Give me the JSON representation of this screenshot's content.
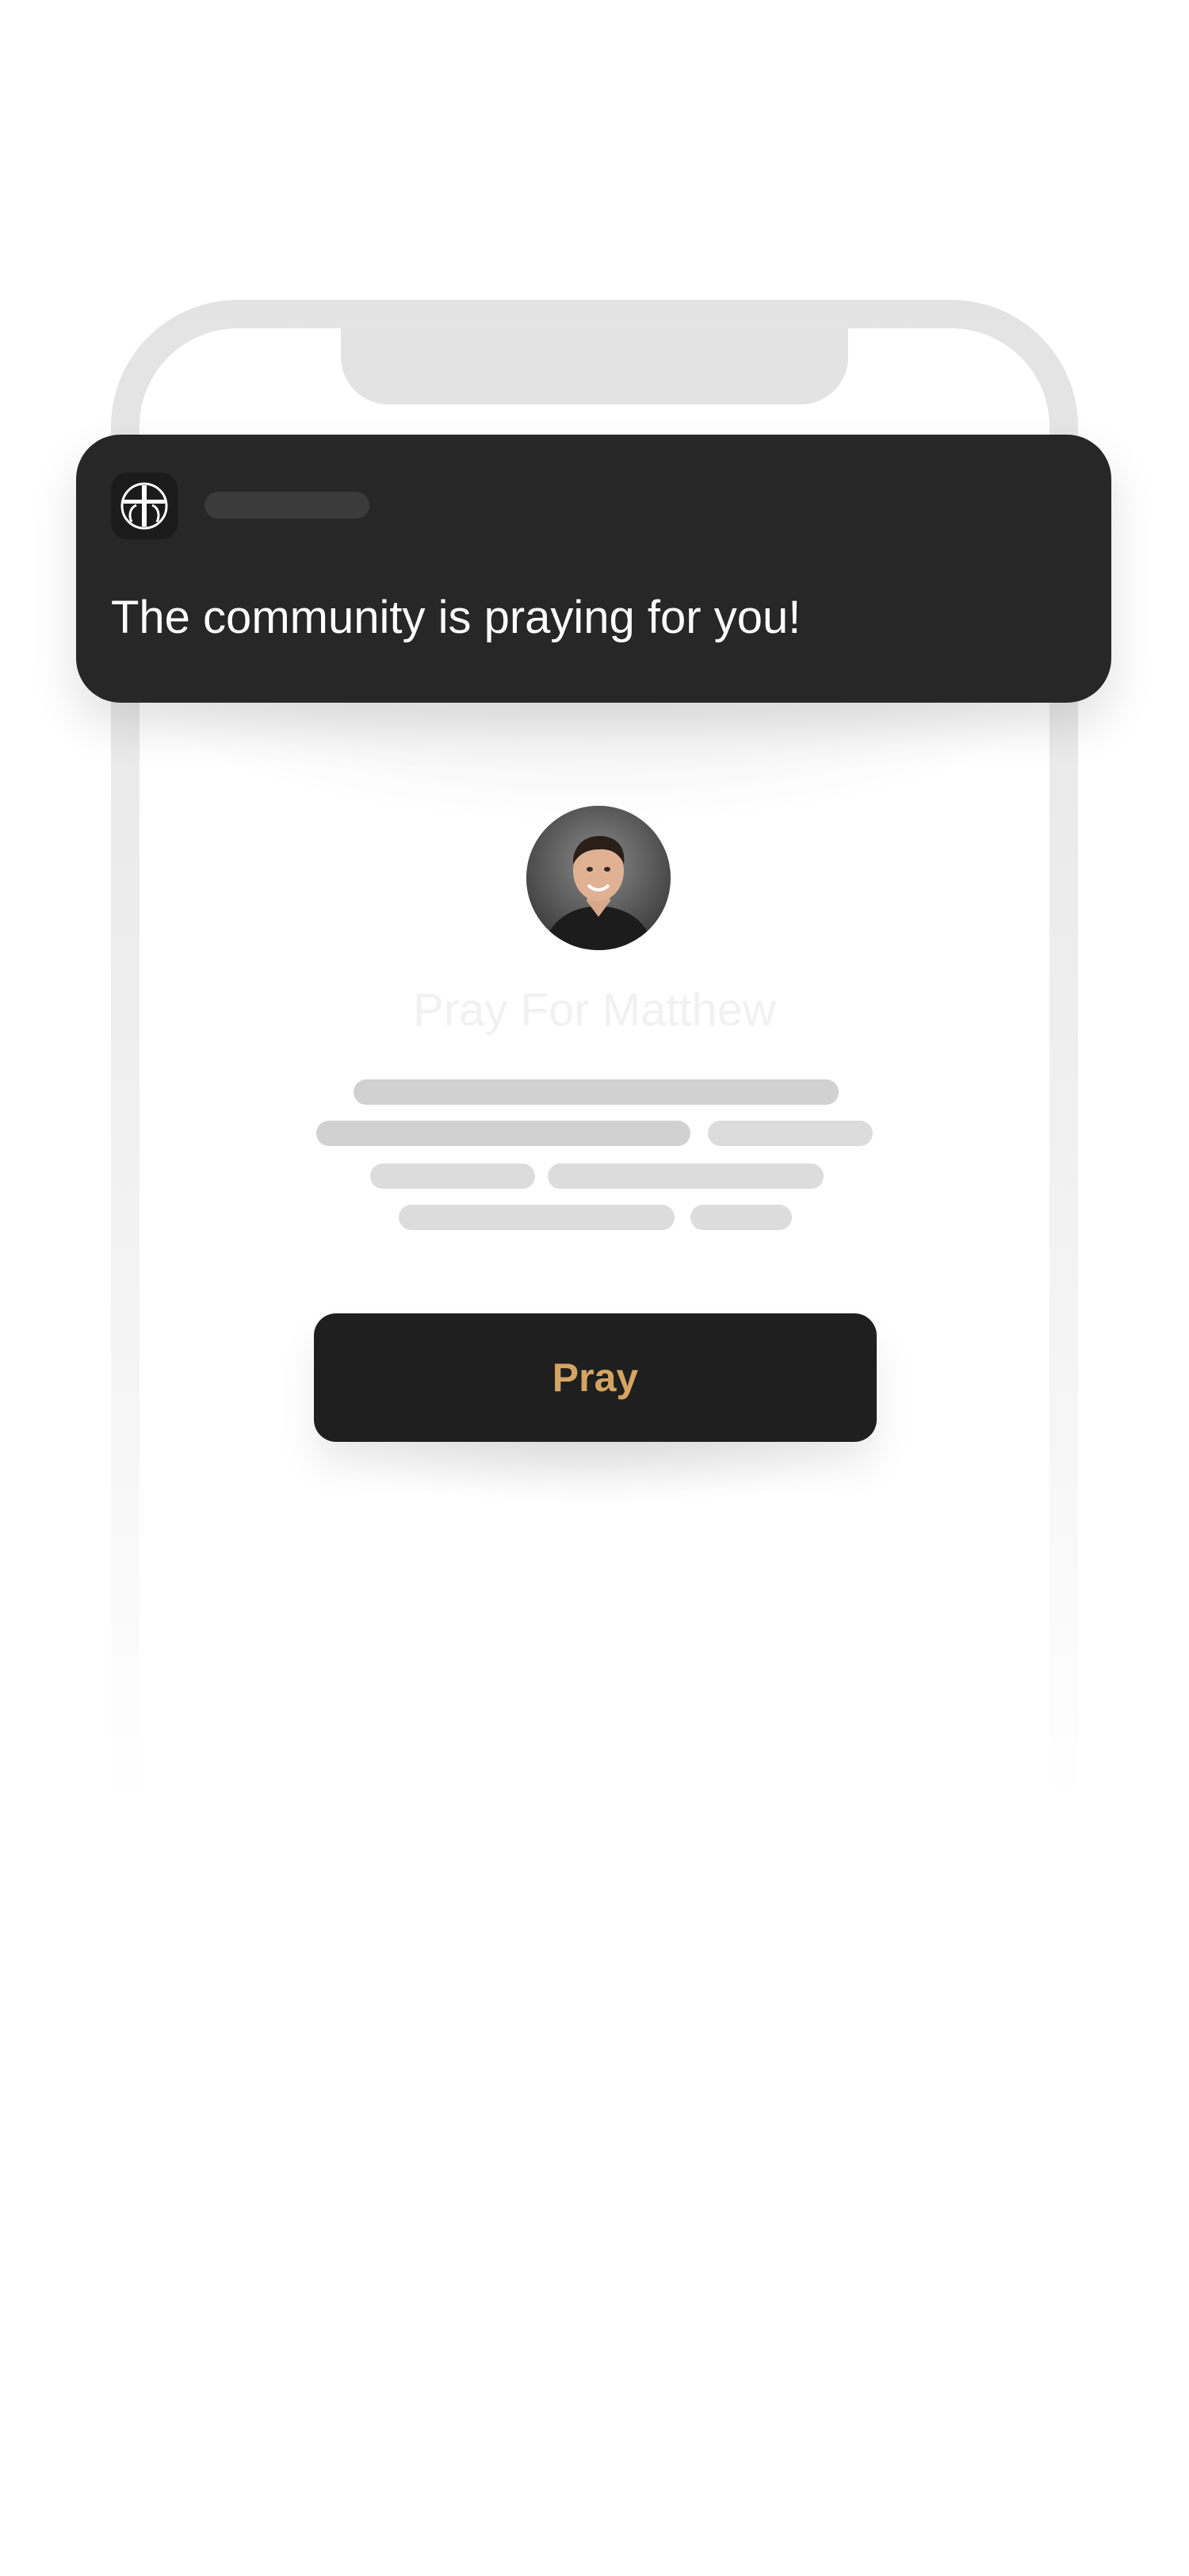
{
  "notification": {
    "message": "The community is praying for you!"
  },
  "profile": {
    "title": "Pray For Matthew"
  },
  "actions": {
    "pray_label": "Pray"
  },
  "colors": {
    "notification_bg": "#272727",
    "button_bg": "#1f1f1f",
    "button_text": "#d4a562",
    "frame": "#e3e3e3",
    "skeleton": "#d1d1d1"
  },
  "icons": {
    "app_icon": "cross-in-circle-icon"
  }
}
